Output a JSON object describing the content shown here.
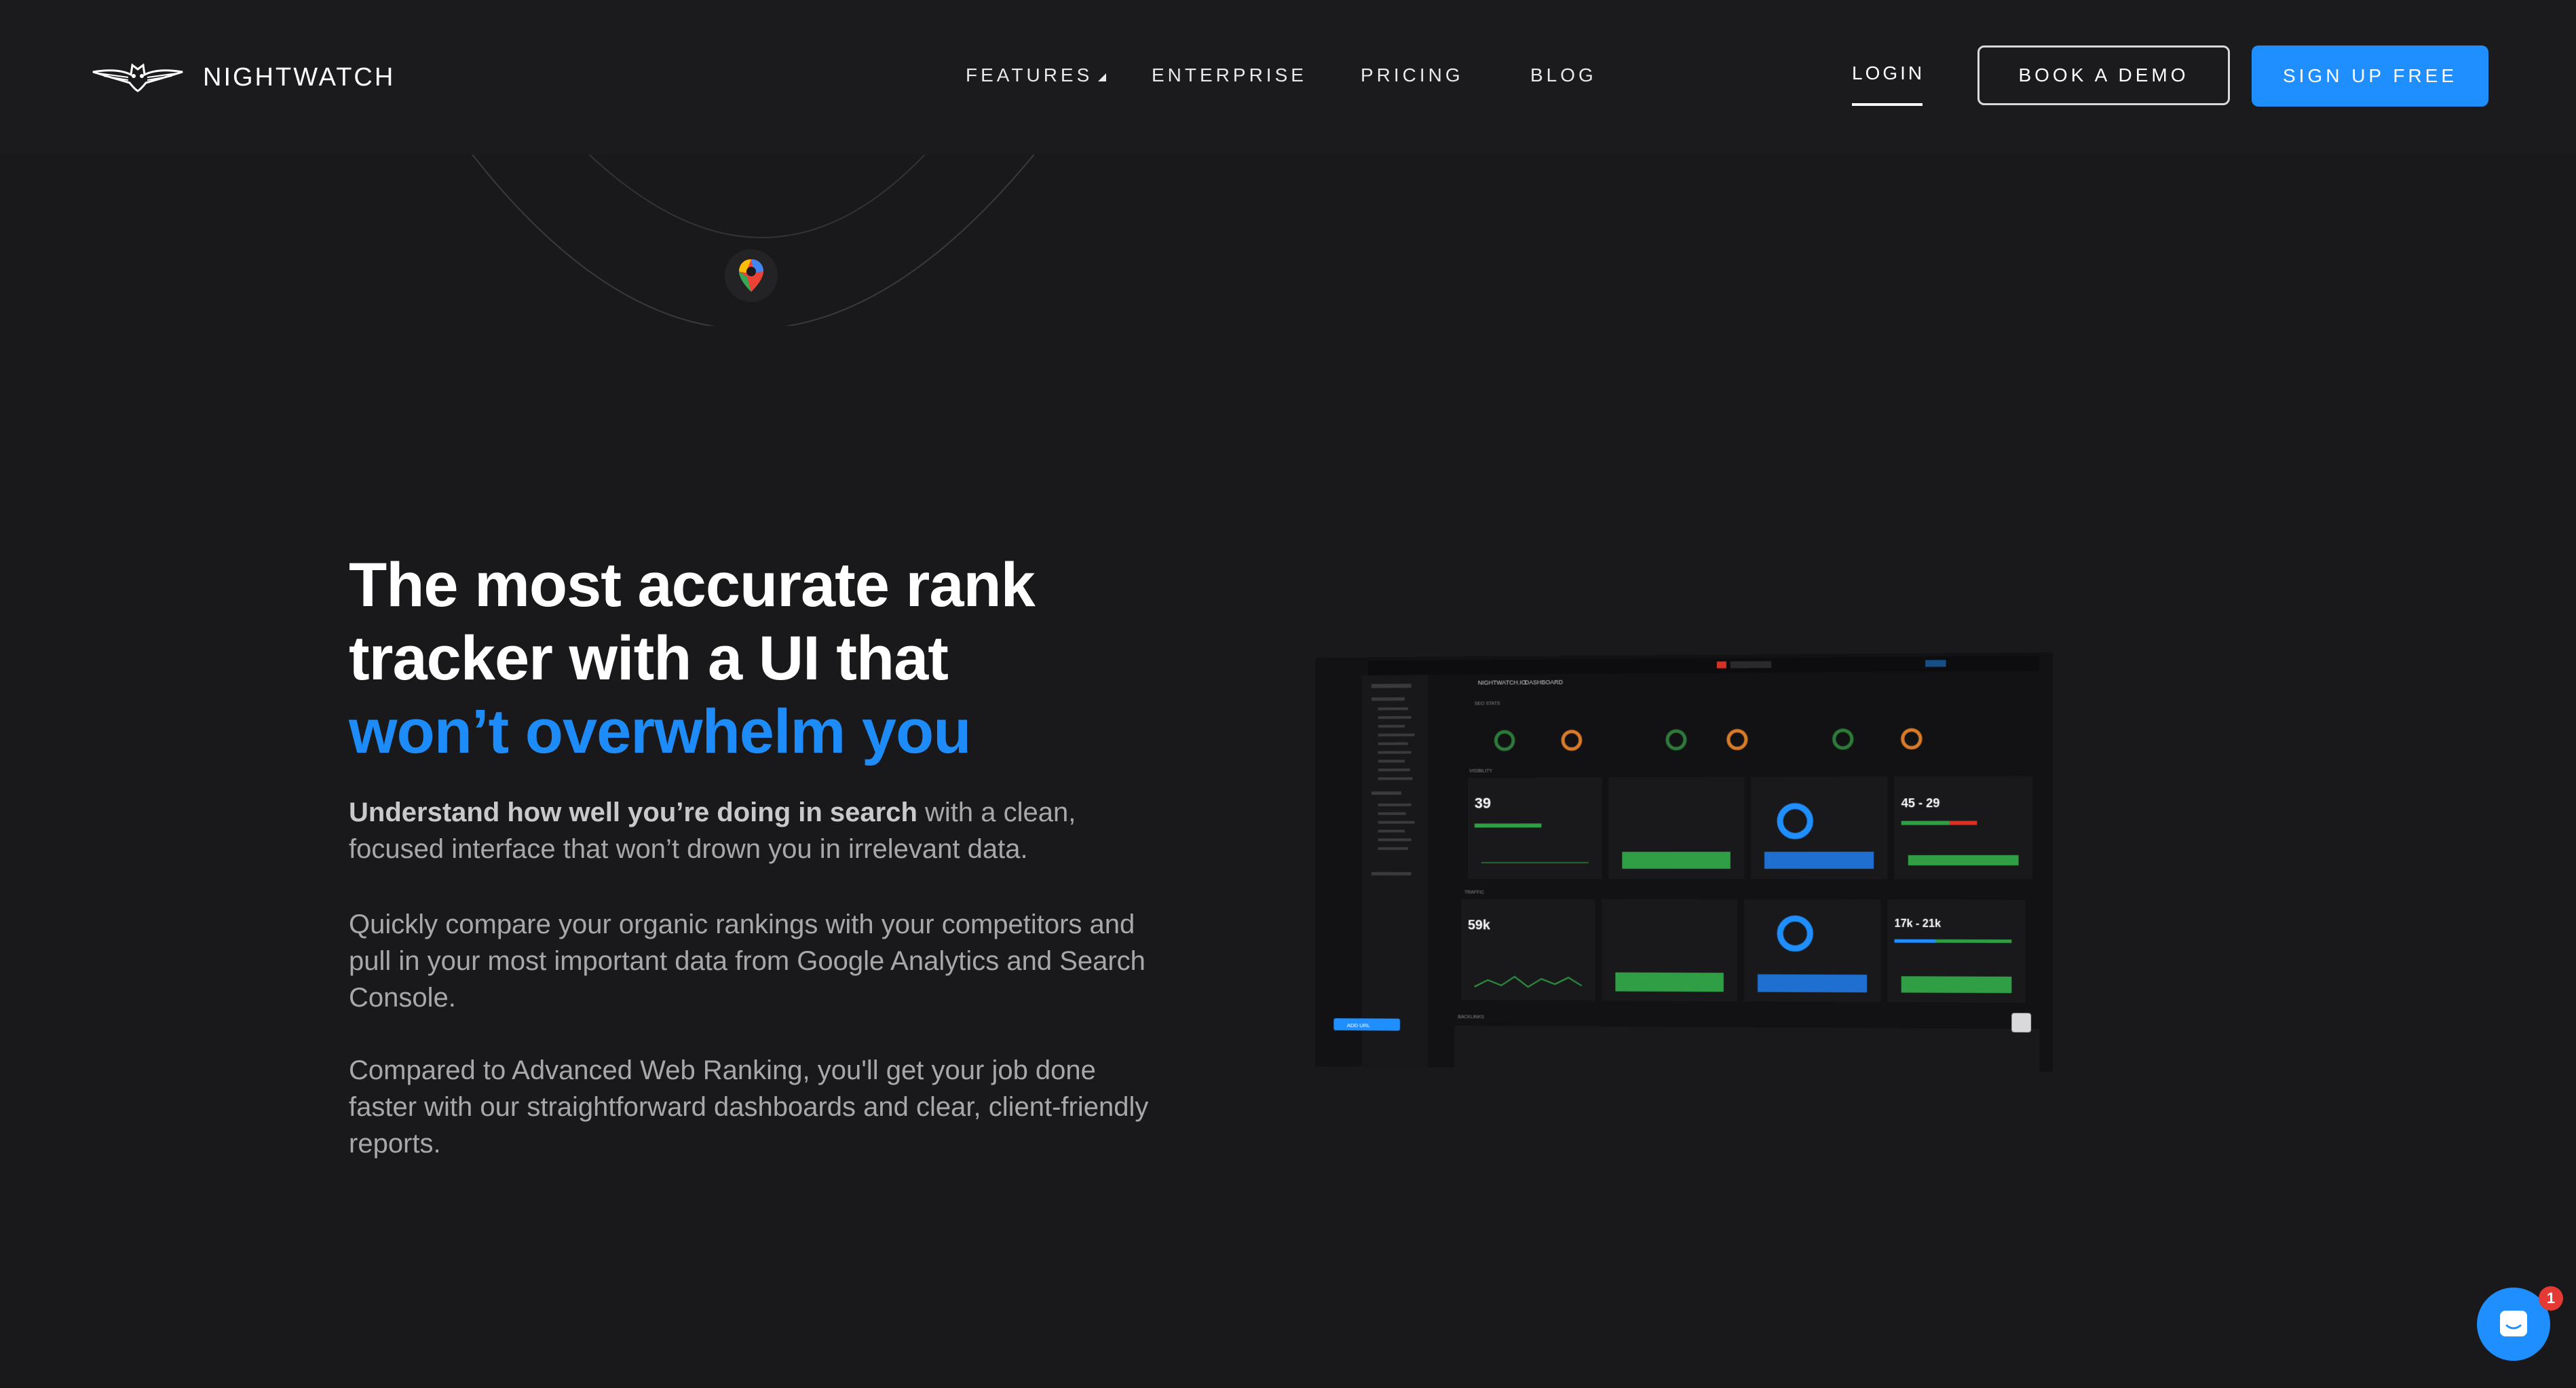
{
  "brand": {
    "name": "NIGHTWATCH"
  },
  "nav": {
    "items": [
      {
        "label": "FEATURES"
      },
      {
        "label": "ENTERPRISE"
      },
      {
        "label": "PRICING"
      },
      {
        "label": "BLOG"
      }
    ],
    "login": "LOGIN",
    "book_demo": "BOOK A DEMO",
    "sign_up": "SIGN UP FREE"
  },
  "hero": {
    "headline_line1": "The most accurate rank",
    "headline_line2": "tracker with a UI that",
    "headline_accent": "won’t overwhelm you",
    "para1_bold": "Understand how well you’re doing in search",
    "para1_rest": " with a clean, focused interface that won’t drown you in irrelevant data.",
    "para2": "Quickly compare your organic rankings with your competitors and pull in your most important data from Google Analytics and Search Console.",
    "para3": "Compared to Advanced Web Ranking, you'll get your job done faster with our straightforward dashboards and clear, client-friendly reports."
  },
  "dashboard": {
    "title": "NIGHTWATCH.IO",
    "subtitle": "DASHBOARD",
    "sections": [
      "SEO STATS",
      "VISIBILITY",
      "TRAFFIC",
      "BACKLINKS"
    ],
    "avg_position": "39",
    "keyword_ratio": "45 - 29",
    "total_sessions": "59k",
    "new_returning": "17k - 21k",
    "add_url": "ADD URL"
  },
  "chat": {
    "badge_count": "1"
  },
  "colors": {
    "accent": "#1d8cf8",
    "button": "#1f8fff",
    "background": "#19191b"
  }
}
